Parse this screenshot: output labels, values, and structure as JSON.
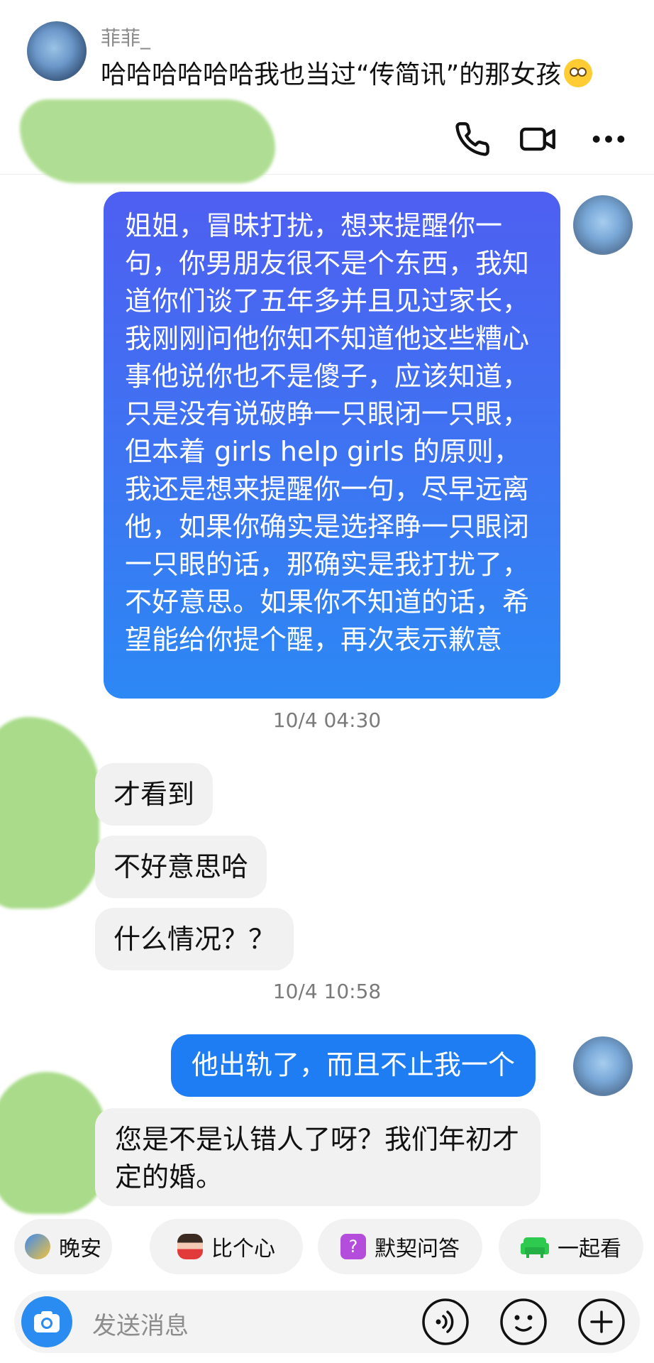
{
  "banner": {
    "sender": "菲菲_",
    "message": "哈哈哈哈哈哈我也当过“传简讯”的那女孩",
    "emoji": "relieved-face"
  },
  "header": {
    "icons": [
      "phone-icon",
      "video-camera-icon",
      "more-icon"
    ]
  },
  "messages": [
    {
      "from": "me",
      "text": "姐姐，冒昧打扰，想来提醒你一句，你男朋友很不是个东西，我知道你们谈了五年多并且见过家长，我刚刚问他你知不知道他这些糟心事他说你也不是傻子，应该知道，只是没有说破睁一只眼闭一只眼，但本着 girls help girls 的原则，我还是想来提醒你一句，尽早远离他，如果你确实是选择睁一只眼闭一只眼的话，那确实是我打扰了，不好意思。如果你不知道的话，希望能给你提个醒，再次表示歉意"
    },
    {
      "timestamp": "10/4 04:30"
    },
    {
      "from": "them",
      "text": "才看到"
    },
    {
      "from": "them",
      "text": "不好意思哈"
    },
    {
      "from": "them",
      "text": "什么情况？？"
    },
    {
      "timestamp": "10/4 10:58"
    },
    {
      "from": "me",
      "text": "他出轨了，而且不止我一个"
    },
    {
      "from": "them",
      "text": "您是不是认错人了呀？我们年初才定的婚。"
    }
  ],
  "quick_replies": [
    {
      "label": "晚安",
      "icon": "moon-bird-icon"
    },
    {
      "label": "比个心",
      "icon": "heart-sticker-icon"
    },
    {
      "label": "默契问答",
      "icon": "question-icon"
    },
    {
      "label": "一起看",
      "icon": "sofa-icon"
    }
  ],
  "composer": {
    "placeholder": "发送消息",
    "icons": [
      "camera-icon",
      "voice-icon",
      "emoji-icon",
      "plus-icon"
    ]
  },
  "colors": {
    "my_bubble_top": "#4e5ff1",
    "my_bubble_bottom": "#2c88f4",
    "my_bubble_short": "#1f7df3",
    "their_bubble": "#f1f1f1",
    "redaction_green": "#a9db8a"
  }
}
